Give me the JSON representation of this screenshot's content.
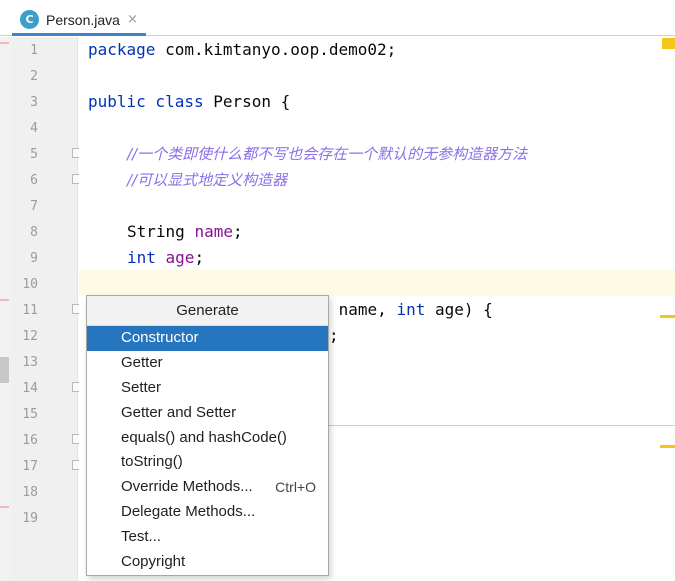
{
  "tab": {
    "icon_letter": "C",
    "filename": "Person.java",
    "close_glyph": "×"
  },
  "gutter": {
    "line_numbers": [
      "1",
      "2",
      "3",
      "4",
      "5",
      "6",
      "7",
      "8",
      "9",
      "10",
      "11",
      "12",
      "13",
      "14",
      "15",
      "16",
      "17",
      "18",
      "19"
    ]
  },
  "code": {
    "l1": {
      "kw": "package",
      "rest": " com.kimtanyo.oop.demo02;"
    },
    "l3": {
      "kw1": "public",
      "kw2": " class",
      "rest": " Person {"
    },
    "l5": {
      "comment": "//一个类即使什么都不写也会存在一个默认的无参构造器方法"
    },
    "l6": {
      "comment": "//可以显式地定义构造器"
    },
    "l8": {
      "type": "String ",
      "field": "name",
      "end": ";"
    },
    "l9": {
      "type": "int",
      "field": " age",
      "end": ";"
    },
    "l11": {
      "pre": " name, ",
      "kw": "int",
      "rest": " age) {"
    },
    "l12": {
      "rest": ";"
    }
  },
  "popup": {
    "title": "Generate",
    "items": [
      {
        "label": "Constructor",
        "shortcut": ""
      },
      {
        "label": "Getter",
        "shortcut": ""
      },
      {
        "label": "Setter",
        "shortcut": ""
      },
      {
        "label": "Getter and Setter",
        "shortcut": ""
      },
      {
        "label": "equals() and hashCode()",
        "shortcut": ""
      },
      {
        "label": "toString()",
        "shortcut": ""
      },
      {
        "label": "Override Methods...",
        "shortcut": "Ctrl+O"
      },
      {
        "label": "Delegate Methods...",
        "shortcut": ""
      },
      {
        "label": "Test...",
        "shortcut": ""
      },
      {
        "label": "Copyright",
        "shortcut": ""
      }
    ],
    "selected_index": 0
  },
  "colors": {
    "accent": "#2675bf",
    "keyword": "#0033b3",
    "field": "#871094",
    "comment": "#8a6fe8",
    "warning": "#f5c518"
  }
}
